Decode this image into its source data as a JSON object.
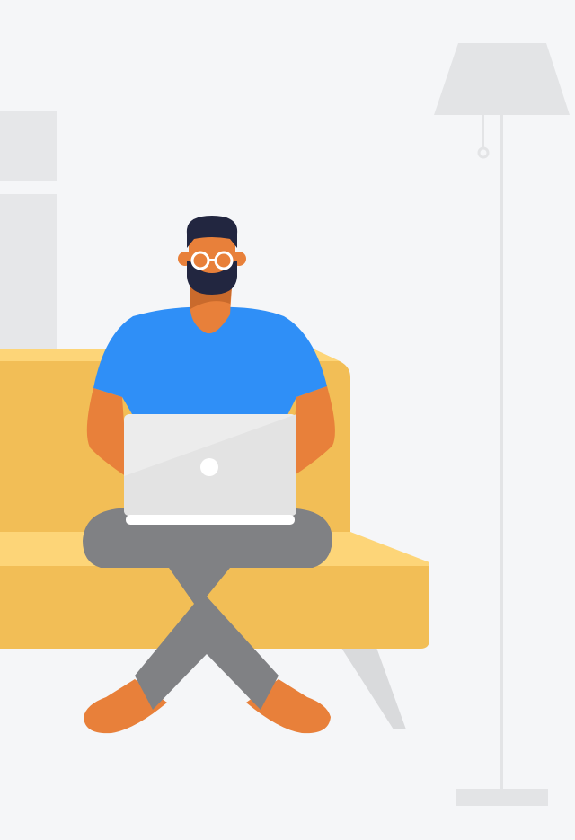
{
  "illustration": {
    "subject": "person-with-laptop-on-sofa",
    "colors": {
      "background": "#f5f6f8",
      "wall_panel": "#e6e7e9",
      "lamp": "#e3e4e6",
      "sofa_main": "#f2be56",
      "sofa_highlight": "#fdd578",
      "sofa_leg": "#d9dadc",
      "shirt": "#2f8ff7",
      "skin": "#e8803a",
      "hair": "#222640",
      "glasses": "#ffffff",
      "pants": "#808184",
      "laptop": "#ececec",
      "laptop_logo": "#ffffff"
    },
    "icons": [
      "lamp-icon",
      "laptop-icon"
    ]
  }
}
